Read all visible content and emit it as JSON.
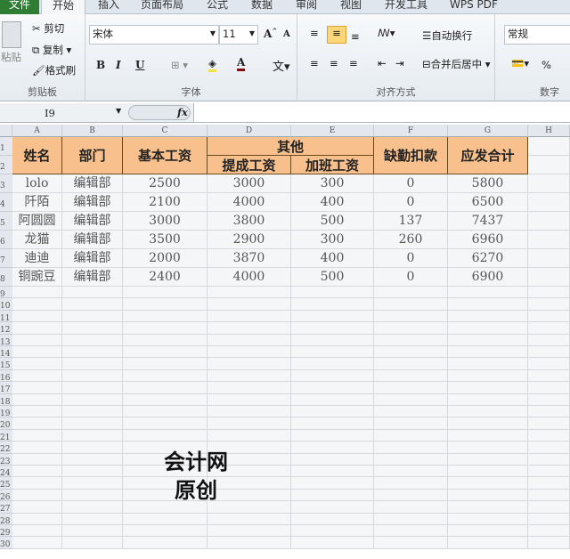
{
  "ribbon_tabs": [
    "文件",
    "开始",
    "插入",
    "页面布局",
    "公式",
    "数据",
    "审阅",
    "视图",
    "开发工具",
    "WPS PDF"
  ],
  "clipboard": {
    "paste": "粘贴",
    "cut": "剪切",
    "copy": "复制",
    "format_painter": "格式刷",
    "label": "剪贴板"
  },
  "font": {
    "name": "宋体",
    "size": "11",
    "bold": "B",
    "italic": "I",
    "underline": "U",
    "font_color": "A",
    "label": "字体"
  },
  "alignment": {
    "wrap": "自动换行",
    "merge": "合并后居中",
    "label": "对齐方式"
  },
  "number": {
    "format": "常规",
    "percent": "%",
    "label": "数字"
  },
  "formula_bar": {
    "name_box": "I9",
    "fx": "fx",
    "value": ""
  },
  "columns": [
    "A",
    "B",
    "C",
    "D",
    "E",
    "F",
    "G",
    "H"
  ],
  "table": {
    "headers": {
      "name": "姓名",
      "dept": "部门",
      "base": "基本工资",
      "other": "其他",
      "commission": "提成工资",
      "overtime": "加班工资",
      "deduction": "缺勤扣款",
      "total": "应发合计"
    },
    "rows": [
      [
        "lolo",
        "编辑部",
        "2500",
        "3000",
        "300",
        "0",
        "5800"
      ],
      [
        "阡陌",
        "编辑部",
        "2100",
        "4000",
        "400",
        "0",
        "6500"
      ],
      [
        "阿圆圆",
        "编辑部",
        "3000",
        "3800",
        "500",
        "137",
        "7437"
      ],
      [
        "龙猫",
        "编辑部",
        "3500",
        "2900",
        "300",
        "260",
        "6960"
      ],
      [
        "迪迪",
        "编辑部",
        "2000",
        "3870",
        "400",
        "0",
        "6270"
      ],
      [
        "铜豌豆",
        "编辑部",
        "2400",
        "4000",
        "500",
        "0",
        "6900"
      ]
    ]
  },
  "watermark": [
    "会计网",
    "原创"
  ],
  "colors": {
    "header_fill": "#f8c08c",
    "file_tab": "#2f7d32"
  }
}
